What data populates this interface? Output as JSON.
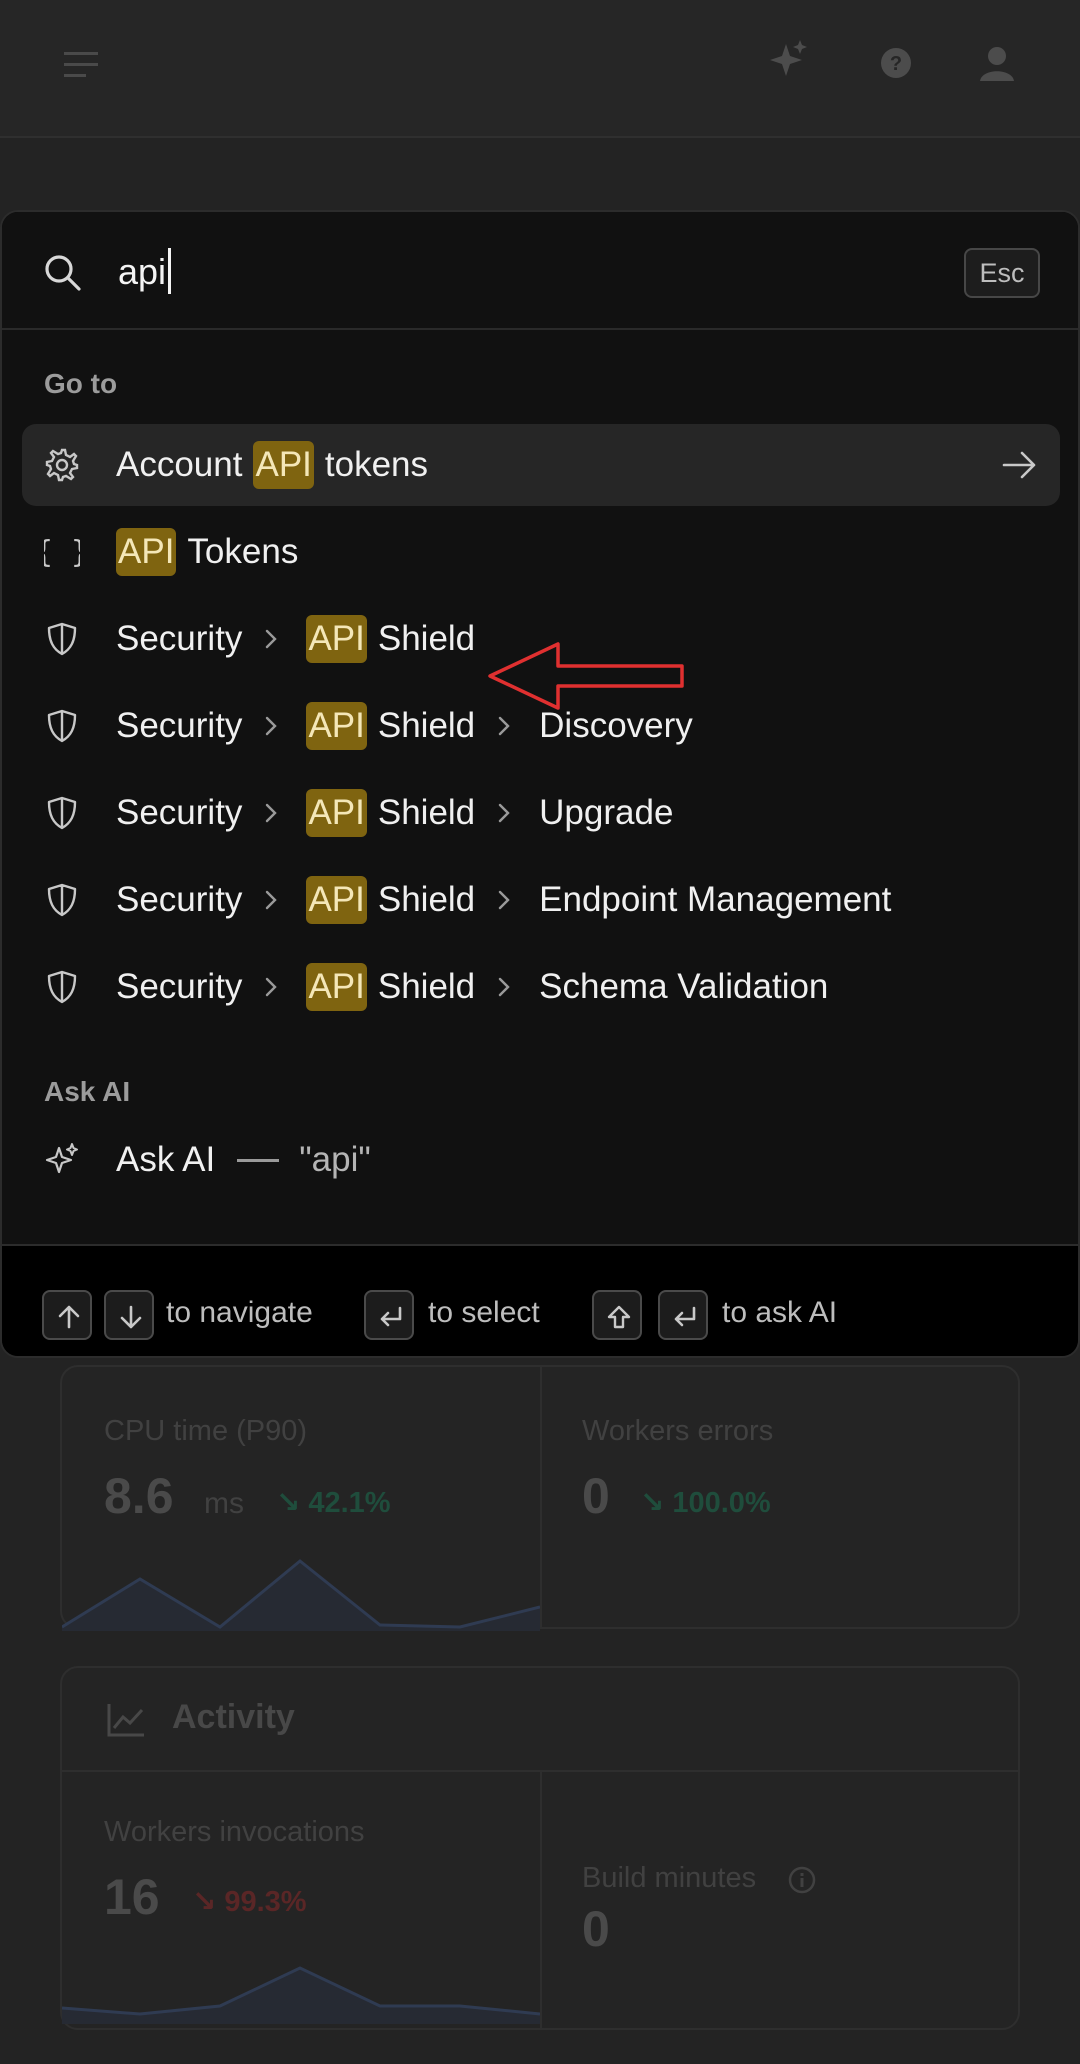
{
  "search": {
    "query": "api",
    "esc_label": "Esc"
  },
  "sections": {
    "goto_label": "Go to",
    "askai_label": "Ask AI"
  },
  "highlight": "API",
  "items": [
    {
      "icon": "gear-icon",
      "pre": "Account",
      "rest": "tokens"
    },
    {
      "icon": "braces-icon",
      "rest": "Tokens"
    },
    {
      "icon": "shield-icon",
      "crumb": "Security",
      "rest": "Shield"
    },
    {
      "icon": "shield-icon",
      "crumb": "Security",
      "rest": "Shield",
      "tail": "Discovery"
    },
    {
      "icon": "shield-icon",
      "crumb": "Security",
      "rest": "Shield",
      "tail": "Upgrade"
    },
    {
      "icon": "shield-icon",
      "crumb": "Security",
      "rest": "Shield",
      "tail": "Endpoint Management"
    },
    {
      "icon": "shield-icon",
      "crumb": "Security",
      "rest": "Shield",
      "tail": "Schema Validation"
    }
  ],
  "ask_ai": {
    "label": "Ask AI",
    "query": "\"api\""
  },
  "footer": {
    "navigate": "to navigate",
    "select": "to select",
    "ask": "to ask AI"
  },
  "background": {
    "metrics": [
      {
        "label": "CPU time (P90)",
        "value": "8.6",
        "unit": "ms",
        "delta": "42.1%"
      },
      {
        "label": "Workers errors",
        "value": "0",
        "delta": "100.0%"
      }
    ],
    "activity": {
      "title": "Activity",
      "invocations_label": "Workers invocations",
      "invocations_value": "16",
      "invocations_delta": "99.3%",
      "build_label": "Build minutes",
      "build_value": "0"
    }
  },
  "colors": {
    "highlight_bg": "#7f6410",
    "annotation_arrow": "#e03030",
    "delta_up": "#1f4d3c",
    "delta_down": "#5a2626"
  }
}
